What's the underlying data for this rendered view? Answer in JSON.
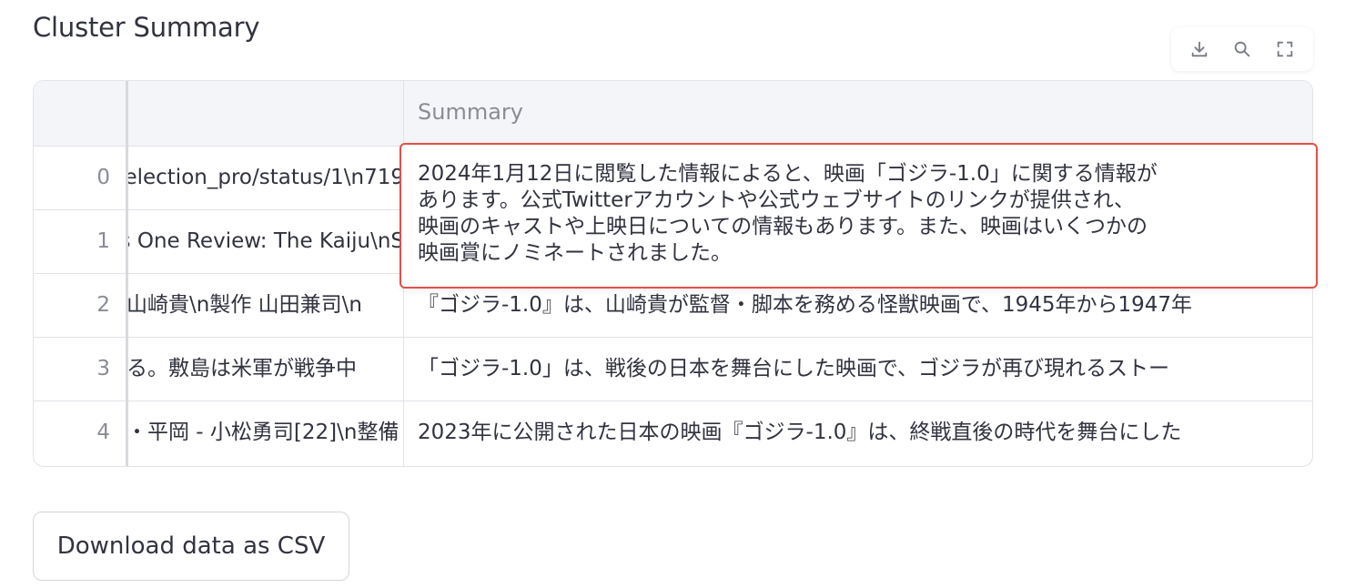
{
  "page": {
    "title": "Cluster Summary"
  },
  "toolbar": {
    "icons": [
      "download-icon",
      "search-icon",
      "fullscreen-icon"
    ]
  },
  "table": {
    "header": {
      "index": "",
      "source": "",
      "summary": "Summary"
    },
    "rows": [
      {
        "index": "0",
        "source": "election_pro/status/1\\n719",
        "summary": ""
      },
      {
        "index": "1",
        "source": "s One Review: The Kaiju\\nS",
        "summary": ""
      },
      {
        "index": "2",
        "source": " 山崎貴\\n製作 山田兼司\\n",
        "summary": "『ゴジラ-1.0』は、山崎貴が監督・脚本を務める怪獣映画で、1945年から1947年"
      },
      {
        "index": "3",
        "source": "る。敷島は米軍が戦争中",
        "summary": "「ゴジラ-1.0」は、戦後の日本を舞台にした映画で、ゴジラが再び現れるストー"
      },
      {
        "index": "4",
        "source": "・平岡 - 小松勇司[22]\\n整備",
        "summary": "2023年に公開された日本の映画『ゴジラ-1.0』は、終戦直後の時代を舞台にした"
      }
    ]
  },
  "tooltip": {
    "lines": [
      "2024年1月12日に閲覧した情報によると、映画「ゴジラ-1.0」に関する情報が",
      "あります。公式Twitterアカウントや公式ウェブサイトのリンクが提供され、",
      "映画のキャストや上映日についての情報もあります。また、映画はいくつかの",
      "映画賞にノミネートされました。"
    ]
  },
  "download_button": {
    "label": "Download data as CSV"
  }
}
